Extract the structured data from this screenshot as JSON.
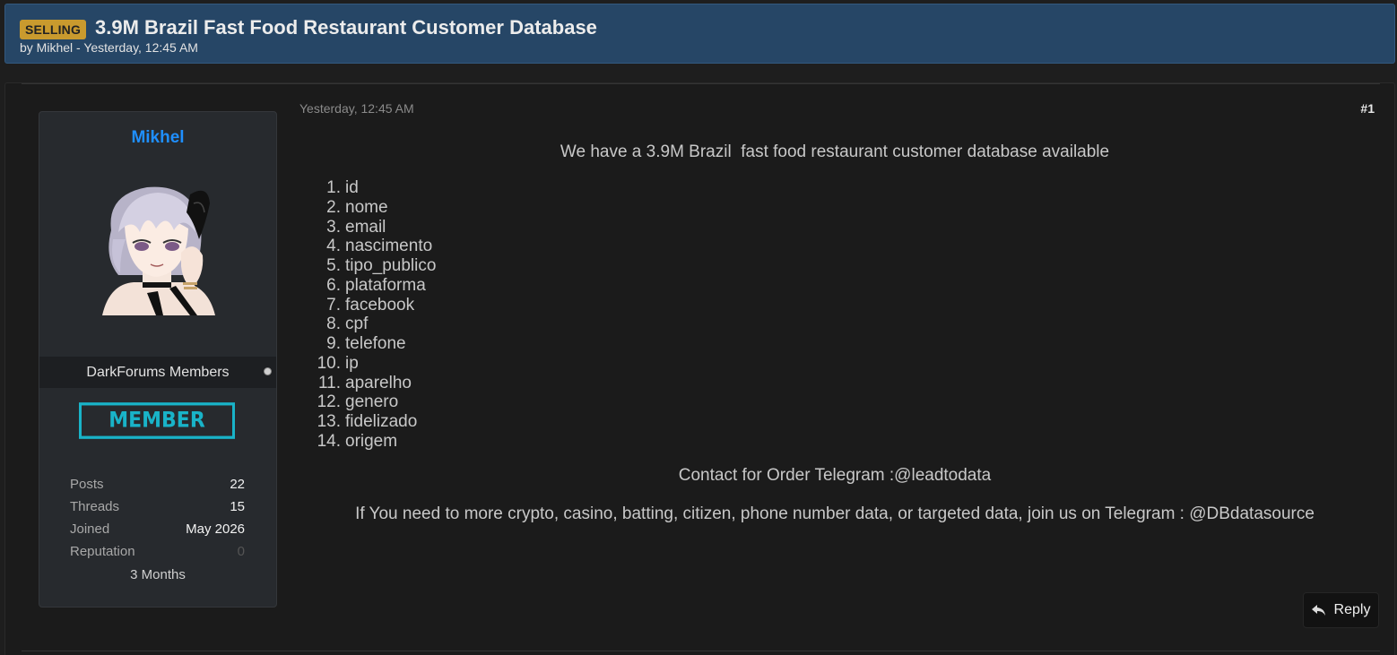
{
  "thread": {
    "prefix": "SELLING",
    "title": "3.9M Brazil Fast Food Restaurant Customer Database",
    "meta": "by Mikhel - Yesterday, 12:45 AM"
  },
  "author": {
    "name": "Mikhel",
    "usergroup": "DarkForums Members",
    "rank": "MEMBER",
    "stats": [
      {
        "label": "Posts",
        "value": "22"
      },
      {
        "label": "Threads",
        "value": "15"
      },
      {
        "label": "Joined",
        "value": "May 2026"
      },
      {
        "label": "Reputation",
        "value": "0"
      }
    ],
    "tenure": "3 Months"
  },
  "post": {
    "date": "Yesterday, 12:45 AM",
    "number": "#1",
    "intro": "We have a 3.9M Brazil  fast food restaurant customer database available",
    "fields": [
      {
        "num": "1.",
        "name": "id"
      },
      {
        "num": "2.",
        "name": "nome"
      },
      {
        "num": "3.",
        "name": "email"
      },
      {
        "num": "4.",
        "name": "nascimento"
      },
      {
        "num": "5.",
        "name": "tipo_publico"
      },
      {
        "num": "6.",
        "name": "plataforma"
      },
      {
        "num": "7.",
        "name": "facebook"
      },
      {
        "num": "8.",
        "name": "cpf"
      },
      {
        "num": "9.",
        "name": "telefone"
      },
      {
        "num": "10.",
        "name": "ip"
      },
      {
        "num": "11.",
        "name": "aparelho"
      },
      {
        "num": "12.",
        "name": "genero"
      },
      {
        "num": "13.",
        "name": "fidelizado"
      },
      {
        "num": "14.",
        "name": "origem"
      }
    ],
    "contact": "Contact for Order Telegram :@leadtodata",
    "footer": "If You need to more crypto, casino, batting, citizen, phone number data, or targeted data, join us on Telegram : @DBdatasource",
    "reply_label": "Reply"
  },
  "colors": {
    "header_bg": "#264666",
    "prefix_bg": "#c99a2e",
    "username": "#1f8fff",
    "rank": "#19b3c8",
    "page_bg": "#1e1e1e"
  },
  "icons": {
    "online_status": "online-dot-icon",
    "reply": "reply-arrow-icon"
  }
}
